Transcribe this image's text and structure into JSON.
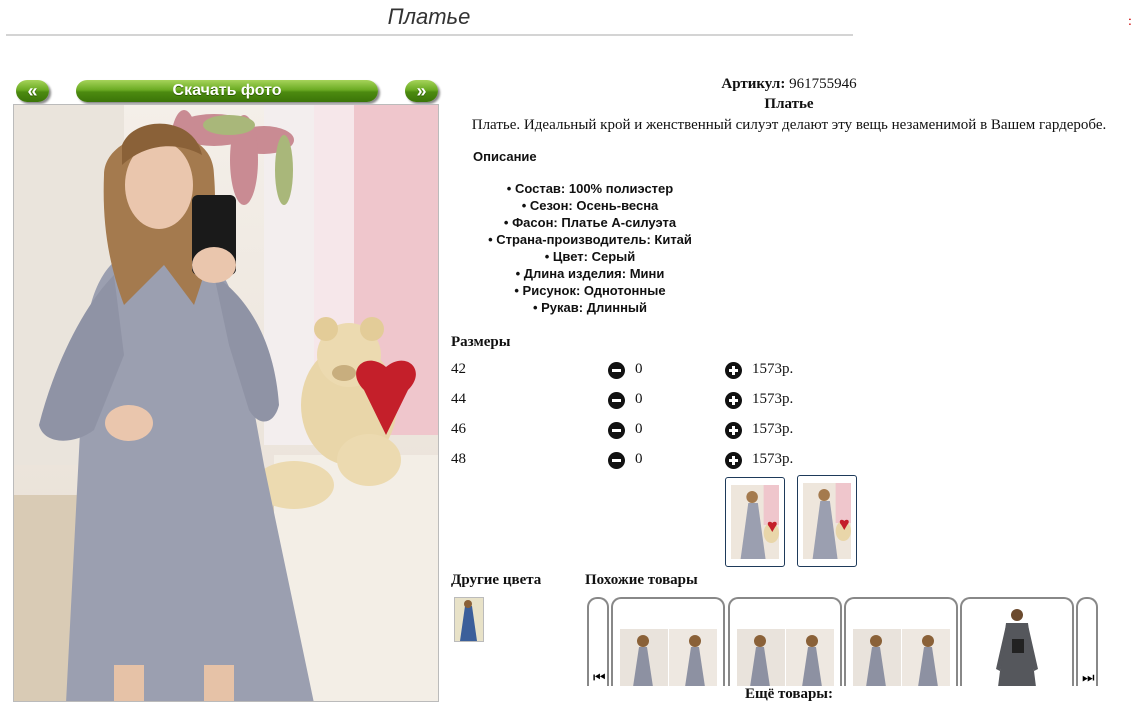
{
  "header": {
    "title": "Платье",
    "corner_mark": ":"
  },
  "gallery": {
    "prev_label": "«",
    "download_label": "Скачать фото",
    "next_label": "»"
  },
  "product": {
    "sku_label": "Артикул:",
    "sku_value": "961755946",
    "name": "Платье",
    "description": "Платье. Идеальный крой и женственный силуэт делают эту вещь незаменимой в Вашем гардеробе.",
    "description_heading": "Описание",
    "attributes": [
      "• Состав: 100% полиэстер",
      "• Сезон: Осень-весна",
      "• Фасон: Платье А-силуэта",
      "• Страна-производитель: Китай",
      "• Цвет: Серый",
      "• Длина изделия: Мини",
      "• Рисунок: Однотонные",
      "• Рукав: Длинный"
    ]
  },
  "sizes": {
    "heading": "Размеры",
    "rows": [
      {
        "size": "42",
        "qty": "0",
        "price": "1573р."
      },
      {
        "size": "44",
        "qty": "0",
        "price": "1573р."
      },
      {
        "size": "46",
        "qty": "0",
        "price": "1573р."
      },
      {
        "size": "48",
        "qty": "0",
        "price": "1573р."
      }
    ]
  },
  "other_colors": {
    "heading": "Другие цвета"
  },
  "similar": {
    "heading": "Похожие товары",
    "prev_icon": "skip-back-icon",
    "next_icon": "skip-forward-icon"
  },
  "footer": {
    "more_label": "Ещё товары:"
  },
  "colors": {
    "accent_green": "#6bab23",
    "thumb_border": "#1e3a5a",
    "dress_gray": "#9b9fb0"
  }
}
